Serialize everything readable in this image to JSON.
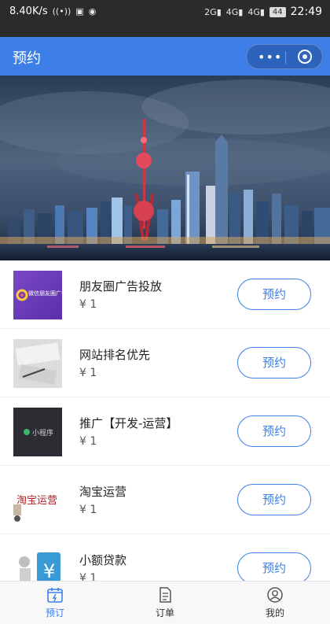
{
  "status_bar": {
    "speed": "8.40K/s",
    "battery": "44",
    "time": "22:49"
  },
  "nav": {
    "title": "预约",
    "more_glyph": "•••"
  },
  "items": [
    {
      "title": "朋友圈广告投放",
      "price": "¥ 1",
      "button": "预约",
      "thumb_text": "微信朋友圈广告"
    },
    {
      "title": "网站排名优先",
      "price": "¥ 1",
      "button": "预约",
      "thumb_text": ""
    },
    {
      "title": "推广【开发-运营】",
      "price": "¥ 1",
      "button": "预约",
      "thumb_text": "小程序"
    },
    {
      "title": "淘宝运营",
      "price": "¥ 1",
      "button": "预约",
      "thumb_text": "淘宝运营"
    },
    {
      "title": "小额贷款",
      "price": "¥ 1",
      "button": "预约",
      "thumb_text": ""
    }
  ],
  "tabs": [
    {
      "label": "预订",
      "icon": "calendar-icon",
      "active": true
    },
    {
      "label": "订单",
      "icon": "document-icon",
      "active": false
    },
    {
      "label": "我的",
      "icon": "user-icon",
      "active": false
    }
  ],
  "colors": {
    "accent": "#3d7fe6",
    "status_bar": "#2b2b2b"
  }
}
